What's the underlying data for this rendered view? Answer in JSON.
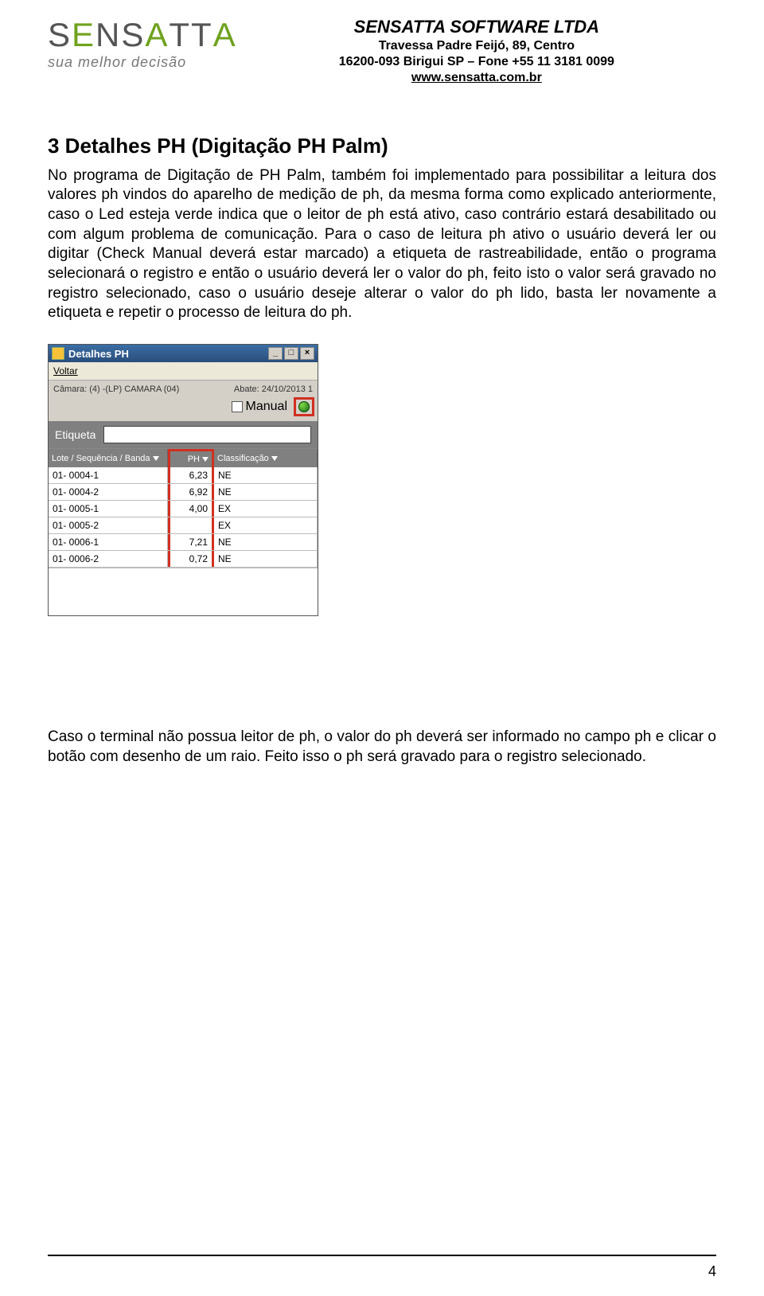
{
  "header": {
    "logo_text_pre": "S",
    "logo_text_accent": "E",
    "logo_text_mid": "NS",
    "logo_text_accent2": "A",
    "logo_text_post": "TT",
    "logo_text_accent3": "A",
    "tagline": "sua melhor decisão",
    "company_name": "SENSATTA SOFTWARE LTDA",
    "address1": "Travessa Padre Feijó, 89, Centro",
    "address2": "16200-093 Birigui SP – Fone +55 11 3181 0099",
    "url": "www.sensatta.com.br"
  },
  "section": {
    "title": "3  Detalhes PH (Digitação PH Palm)",
    "para1": "No programa de Digitação de PH Palm, também foi implementado para possibilitar a leitura dos valores ph vindos do aparelho de medição de ph, da mesma forma como explicado anteriormente, caso o Led esteja verde indica que o leitor de ph está ativo, caso contrário estará desabilitado ou com algum problema de comunicação. Para o caso de leitura ph ativo o usuário deverá ler ou digitar (Check Manual deverá estar marcado) a etiqueta de rastreabilidade, então o programa selecionará o registro e então o usuário deverá ler o valor do ph, feito isto o valor será gravado no registro selecionado, caso o usuário deseje alterar o valor do ph lido, basta ler novamente a etiqueta e repetir o processo de leitura do ph.",
    "para2": "Caso o terminal não possua leitor de ph, o valor do ph deverá ser informado no campo ph e clicar o botão com desenho de um raio. Feito isso o ph será gravado para o registro selecionado."
  },
  "palm": {
    "title": "Detalhes PH",
    "menu_voltar": "Voltar",
    "camara_label": "Câmara: (4) -(LP) CAMARA (04)",
    "abate_label": "Abate: 24/10/2013 1",
    "manual_label": "Manual",
    "etiqueta_label": "Etiqueta",
    "columns": {
      "lote": "Lote / Sequência / Banda",
      "ph": "PH",
      "class": "Classificação"
    },
    "rows": [
      {
        "lote": "01- 0004-1",
        "ph": "6,23",
        "class": "NE"
      },
      {
        "lote": "01- 0004-2",
        "ph": "6,92",
        "class": "NE"
      },
      {
        "lote": "01- 0005-1",
        "ph": "4,00",
        "class": "EX"
      },
      {
        "lote": "01- 0005-2",
        "ph": "",
        "class": "EX"
      },
      {
        "lote": "01- 0006-1",
        "ph": "7,21",
        "class": "NE"
      },
      {
        "lote": "01- 0006-2",
        "ph": "0,72",
        "class": "NE"
      }
    ]
  },
  "page_number": "4"
}
